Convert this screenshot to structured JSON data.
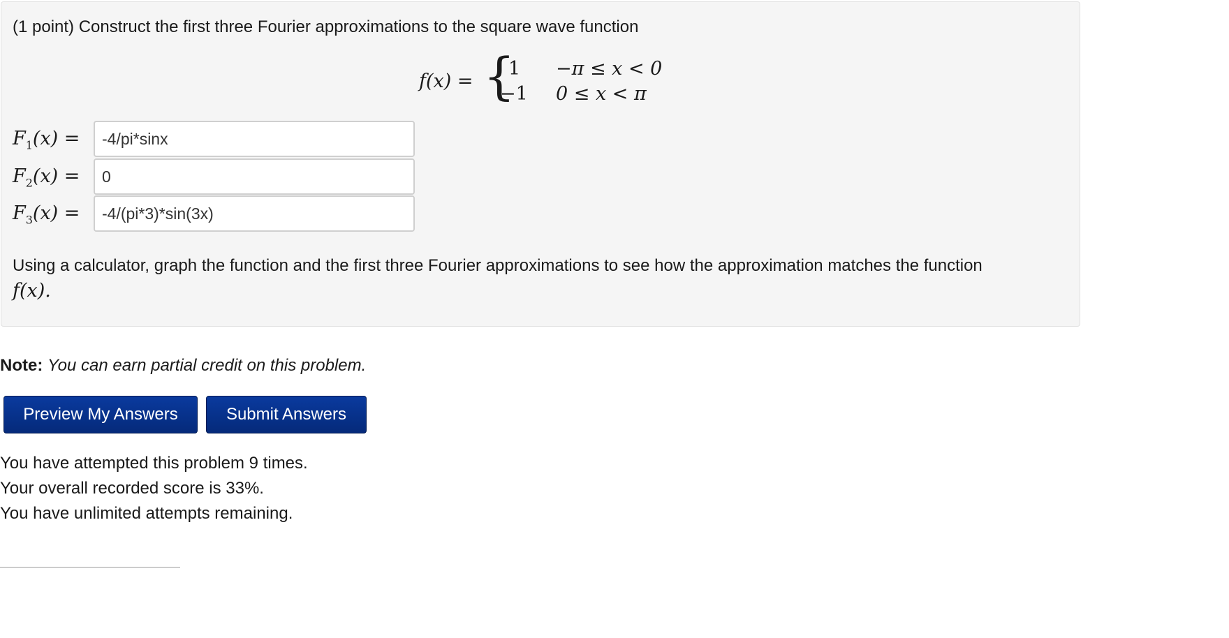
{
  "problem": {
    "title": "(1 point) Construct the first three Fourier approximations to the square wave function",
    "formula": {
      "lhs": "f(x) =",
      "values": [
        "1",
        "−1"
      ],
      "conditions": [
        "−π ≤ x < 0",
        "0 ≤ x < π"
      ]
    },
    "answers": [
      {
        "label_F": "F",
        "label_sub": "1",
        "label_rest": "(x) =",
        "value": "-4/pi*sinx"
      },
      {
        "label_F": "F",
        "label_sub": "2",
        "label_rest": "(x) =",
        "value": "0"
      },
      {
        "label_F": "F",
        "label_sub": "3",
        "label_rest": "(x) =",
        "value": "-4/(pi*3)*sin(3x)"
      }
    ],
    "instructions": "Using a calculator, graph the function and the first three Fourier approximations to see how the approximation matches the function",
    "instructions_math": "f(x)."
  },
  "note": {
    "label": "Note:",
    "text": "You can earn partial credit on this problem."
  },
  "buttons": {
    "preview": "Preview My Answers",
    "submit": "Submit Answers"
  },
  "status": {
    "attempts": "You have attempted this problem 9 times.",
    "score": "Your overall recorded score is 33%.",
    "remaining": "You have unlimited attempts remaining."
  }
}
